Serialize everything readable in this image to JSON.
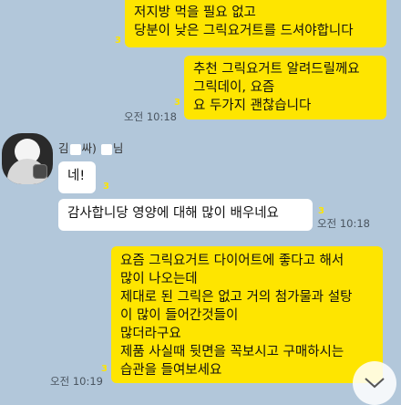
{
  "messages": {
    "m1": {
      "text": "저지방 먹을 필요 없고\n당분이 낮은 그릭요거트를 드셔야합니다",
      "unread": "3"
    },
    "m2": {
      "text": "추천 그릭요거트 알려드릴께요\n그릭데이, 요즘\n요 두가지 괜찮습니다",
      "unread": "3",
      "time": "오전 10:18"
    },
    "sender": {
      "name_left": "김",
      "name_mid": "싸) ",
      "name_right": "님"
    },
    "m3": {
      "text": "네!",
      "unread": "3"
    },
    "m4": {
      "text": "감사합니당 영양에 대해 많이 배우네요",
      "unread": "3",
      "time": "오전 10:18"
    },
    "m5": {
      "text": "요즘 그릭요거트 다이어트에 좋다고 해서\n많이 나오는데\n제대로 된 그릭은 없고 거의 첨가물과 설탕\n이 많이 들어간것들이\n많더라구요\n제품 사실때 뒷면을 꼭보시고 구매하시는\n습관을 들여보세요",
      "unread": "3",
      "time": "오전 10:19"
    }
  },
  "colors": {
    "background": "#b2c7da",
    "my_bubble": "#fee500",
    "their_bubble": "#ffffff"
  },
  "icons": {
    "scroll": "chevron-down-icon"
  }
}
